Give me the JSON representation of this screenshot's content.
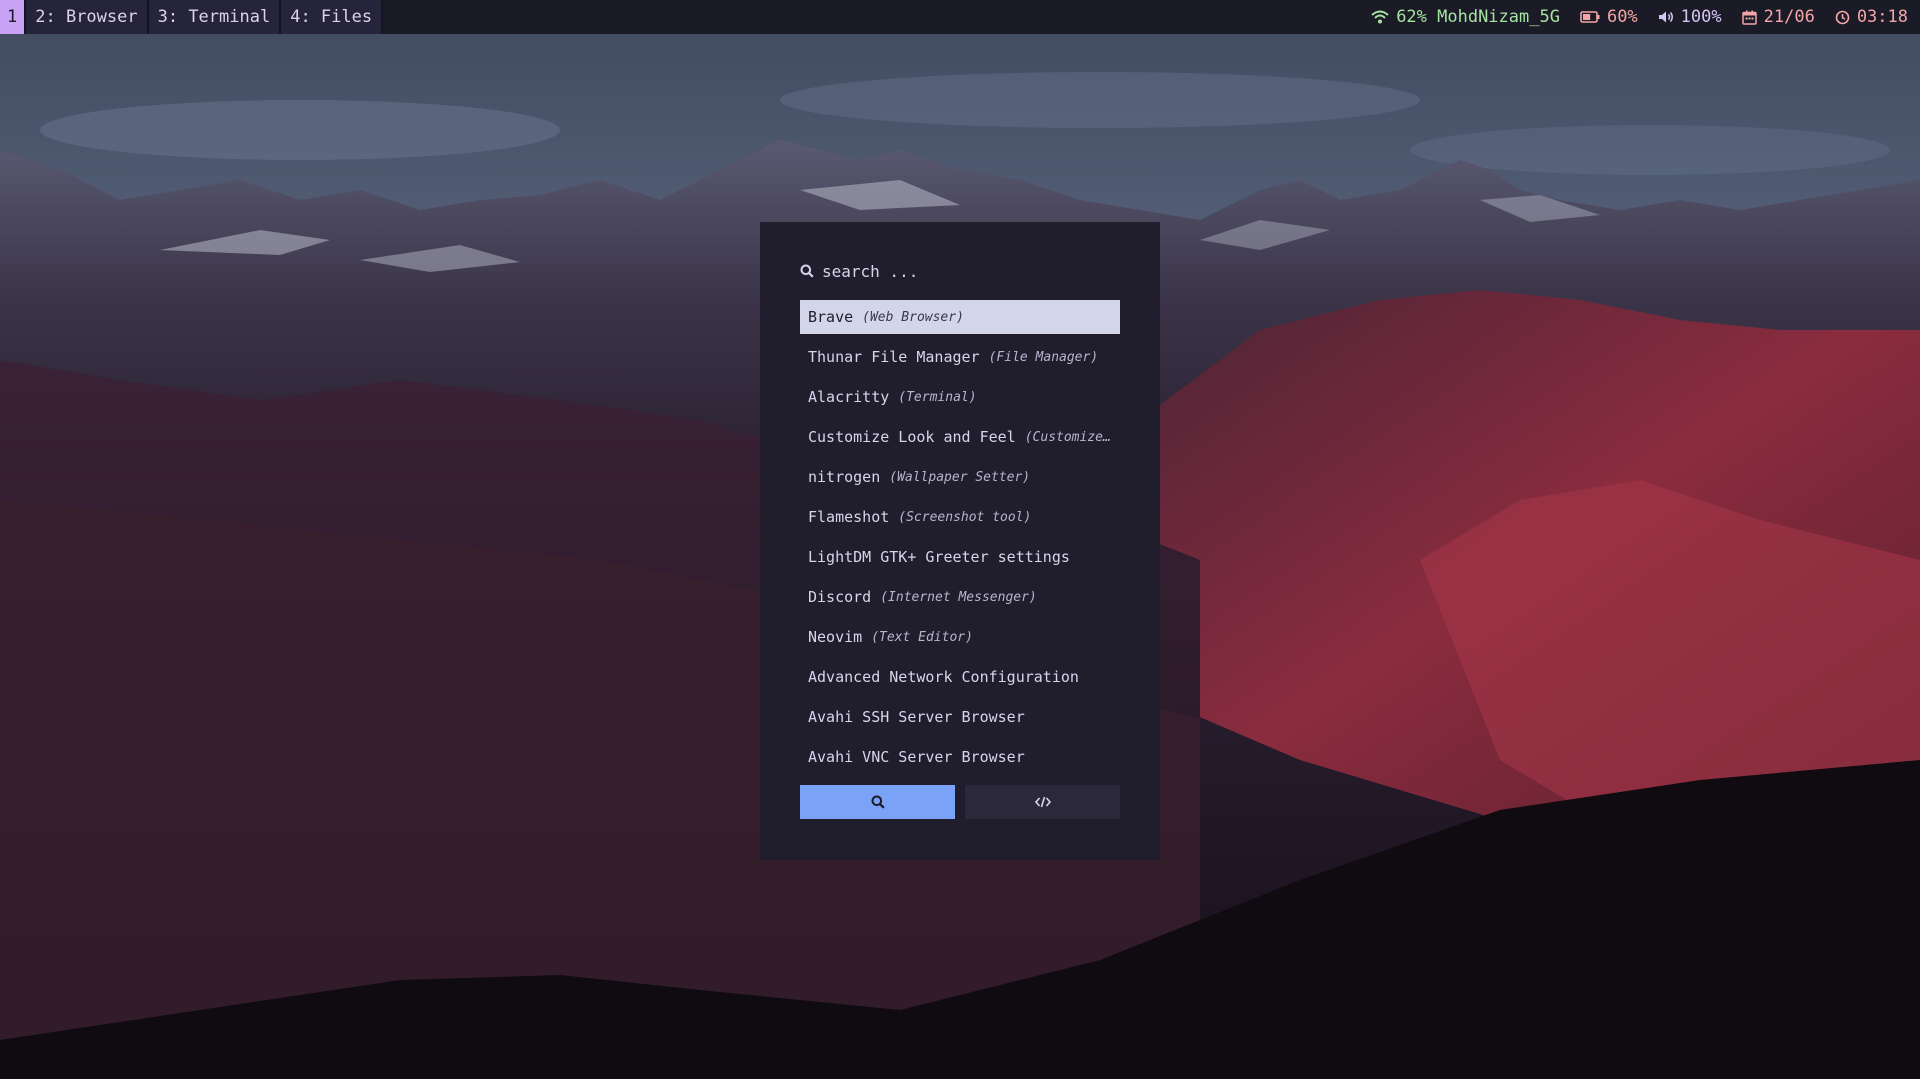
{
  "topbar": {
    "workspaces": [
      {
        "label": "1",
        "active": true
      },
      {
        "label": "2: Browser",
        "active": false
      },
      {
        "label": "3: Terminal",
        "active": false
      },
      {
        "label": "4: Files",
        "active": false
      }
    ],
    "wifi": {
      "icon": "wifi-icon",
      "text": "62% MohdNizam_5G",
      "color": "#a6e3a1"
    },
    "battery": {
      "icon": "battery-icon",
      "text": "60%",
      "level": 0.6,
      "color": "#f3a6a6"
    },
    "volume": {
      "icon": "volume-icon",
      "text": "100%",
      "color": "#d6c3f5"
    },
    "date": {
      "icon": "calendar-icon",
      "text": "21/06",
      "color": "#f3a6a6"
    },
    "time": {
      "icon": "clock-icon",
      "text": "03:18",
      "color": "#f3a6a6"
    }
  },
  "launcher": {
    "search": {
      "icon": "search-icon",
      "placeholder": "search ...",
      "value": ""
    },
    "items": [
      {
        "name": "Brave",
        "desc": "(Web Browser)",
        "selected": true
      },
      {
        "name": "Thunar File Manager",
        "desc": "(File Manager)",
        "selected": false
      },
      {
        "name": "Alacritty",
        "desc": "(Terminal)",
        "selected": false
      },
      {
        "name": "Customize Look and Feel",
        "desc": "(Customize…",
        "selected": false
      },
      {
        "name": "nitrogen",
        "desc": "(Wallpaper Setter)",
        "selected": false
      },
      {
        "name": "Flameshot",
        "desc": "(Screenshot tool)",
        "selected": false
      },
      {
        "name": "LightDM GTK+ Greeter settings",
        "desc": "",
        "selected": false
      },
      {
        "name": "Discord",
        "desc": "(Internet Messenger)",
        "selected": false
      },
      {
        "name": "Neovim",
        "desc": "(Text Editor)",
        "selected": false
      },
      {
        "name": "Advanced Network Configuration",
        "desc": "",
        "selected": false
      },
      {
        "name": "Avahi SSH Server Browser",
        "desc": "",
        "selected": false
      },
      {
        "name": "Avahi VNC Server Browser",
        "desc": "",
        "selected": false
      }
    ],
    "modes": [
      {
        "icon": "search-icon",
        "active": true
      },
      {
        "icon": "code-icon",
        "active": false
      }
    ]
  },
  "colors": {
    "bar_bg": "#1b1a27",
    "workspace_active": "#c9a2f5",
    "launcher_bg": "#201e2d",
    "selected_bg": "#d3d6e8",
    "accent": "#7aa2f7"
  }
}
